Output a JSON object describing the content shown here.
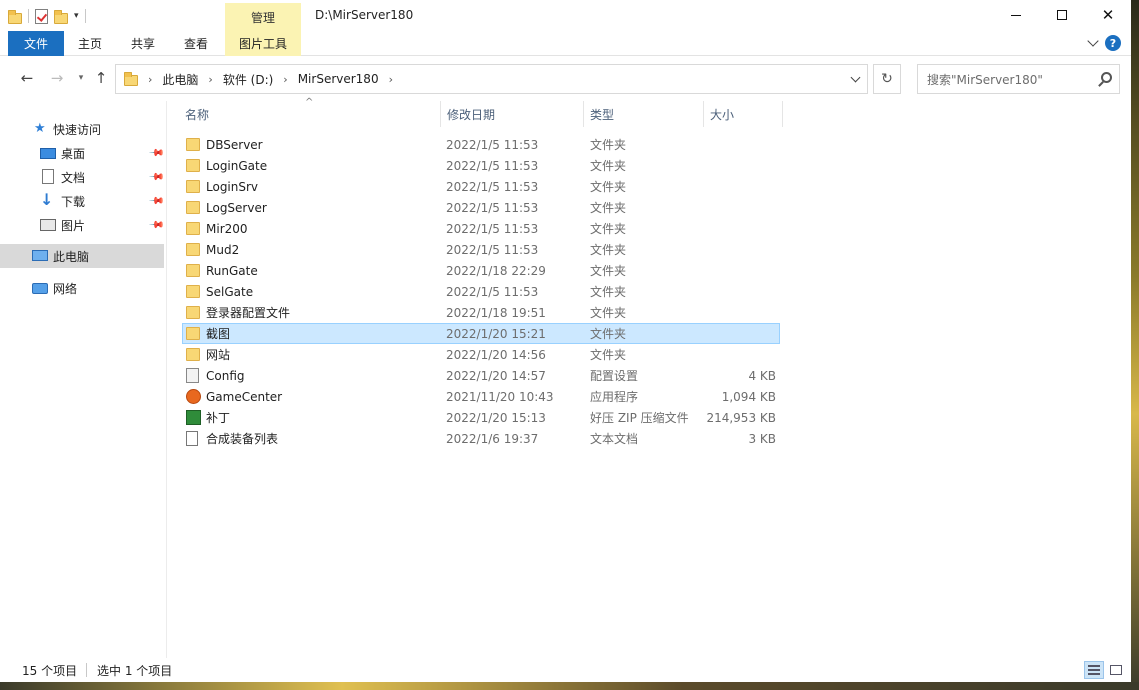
{
  "window": {
    "title": "D:\\MirServer180",
    "context_tab": "管理"
  },
  "ribbon": {
    "tabs": [
      {
        "label": "文件"
      },
      {
        "label": "主页"
      },
      {
        "label": "共享"
      },
      {
        "label": "查看"
      },
      {
        "label": "图片工具"
      }
    ]
  },
  "address": {
    "breadcrumbs": [
      "此电脑",
      "软件 (D:)",
      "MirServer180"
    ]
  },
  "search": {
    "placeholder": "搜索\"MirServer180\""
  },
  "navpane": {
    "items": [
      {
        "label": "快速访问",
        "icon": "star-icon",
        "pinned": false
      },
      {
        "label": "桌面",
        "icon": "desktop-icon",
        "pinned": true
      },
      {
        "label": "文档",
        "icon": "document-icon",
        "pinned": true
      },
      {
        "label": "下载",
        "icon": "download-icon",
        "pinned": true
      },
      {
        "label": "图片",
        "icon": "pictures-icon",
        "pinned": true
      },
      {
        "label": "此电脑",
        "icon": "computer-icon",
        "pinned": false,
        "selected": true
      },
      {
        "label": "网络",
        "icon": "network-icon",
        "pinned": false
      }
    ]
  },
  "columns": {
    "name": "名称",
    "date": "修改日期",
    "type": "类型",
    "size": "大小"
  },
  "files": [
    {
      "name": "DBServer",
      "date": "2022/1/5 11:53",
      "type": "文件夹",
      "size": "",
      "icon": "folder-icon"
    },
    {
      "name": "LoginGate",
      "date": "2022/1/5 11:53",
      "type": "文件夹",
      "size": "",
      "icon": "folder-icon"
    },
    {
      "name": "LoginSrv",
      "date": "2022/1/5 11:53",
      "type": "文件夹",
      "size": "",
      "icon": "folder-icon"
    },
    {
      "name": "LogServer",
      "date": "2022/1/5 11:53",
      "type": "文件夹",
      "size": "",
      "icon": "folder-icon"
    },
    {
      "name": "Mir200",
      "date": "2022/1/5 11:53",
      "type": "文件夹",
      "size": "",
      "icon": "folder-icon"
    },
    {
      "name": "Mud2",
      "date": "2022/1/5 11:53",
      "type": "文件夹",
      "size": "",
      "icon": "folder-icon"
    },
    {
      "name": "RunGate",
      "date": "2022/1/18 22:29",
      "type": "文件夹",
      "size": "",
      "icon": "folder-icon"
    },
    {
      "name": "SelGate",
      "date": "2022/1/5 11:53",
      "type": "文件夹",
      "size": "",
      "icon": "folder-icon"
    },
    {
      "name": "登录器配置文件",
      "date": "2022/1/18 19:51",
      "type": "文件夹",
      "size": "",
      "icon": "folder-icon"
    },
    {
      "name": "截图",
      "date": "2022/1/20 15:21",
      "type": "文件夹",
      "size": "",
      "icon": "folder-icon",
      "selected": true
    },
    {
      "name": "网站",
      "date": "2022/1/20 14:56",
      "type": "文件夹",
      "size": "",
      "icon": "folder-icon"
    },
    {
      "name": "Config",
      "date": "2022/1/20 14:57",
      "type": "配置设置",
      "size": "4 KB",
      "icon": "config-file-icon"
    },
    {
      "name": "GameCenter",
      "date": "2021/11/20 10:43",
      "type": "应用程序",
      "size": "1,094 KB",
      "icon": "application-icon"
    },
    {
      "name": "补丁",
      "date": "2022/1/20 15:13",
      "type": "好压 ZIP 压缩文件",
      "size": "214,953 KB",
      "icon": "zip-archive-icon"
    },
    {
      "name": "合成装备列表",
      "date": "2022/1/6 19:37",
      "type": "文本文档",
      "size": "3 KB",
      "icon": "text-document-icon"
    }
  ],
  "status": {
    "item_count": "15 个项目",
    "selection": "选中 1 个项目"
  }
}
